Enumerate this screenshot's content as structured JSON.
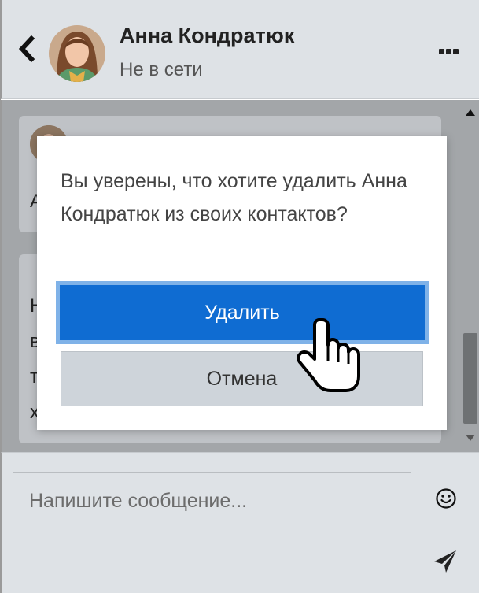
{
  "header": {
    "back_icon": "chevron-left-icon",
    "contact_name": "Анна Кондратюк",
    "contact_status": "Не в сети",
    "more_icon": "more-horizontal-icon"
  },
  "messages": {
    "fragments": [
      "А",
      "Н",
      "в",
      "т",
      "х"
    ]
  },
  "composer": {
    "placeholder": "Напишите сообщение...",
    "emoji_icon": "smiley-icon",
    "send_icon": "paper-plane-icon"
  },
  "dialog": {
    "text": "Вы уверены, что хотите удалить Анна Кондратюк из своих контактов?",
    "confirm_label": "Удалить",
    "cancel_label": "Отмена"
  },
  "colors": {
    "primary": "#0f6cd2",
    "header_bg": "#dee2e6",
    "overlay": "#a3a6a9",
    "cancel_bg": "#ced4da"
  }
}
